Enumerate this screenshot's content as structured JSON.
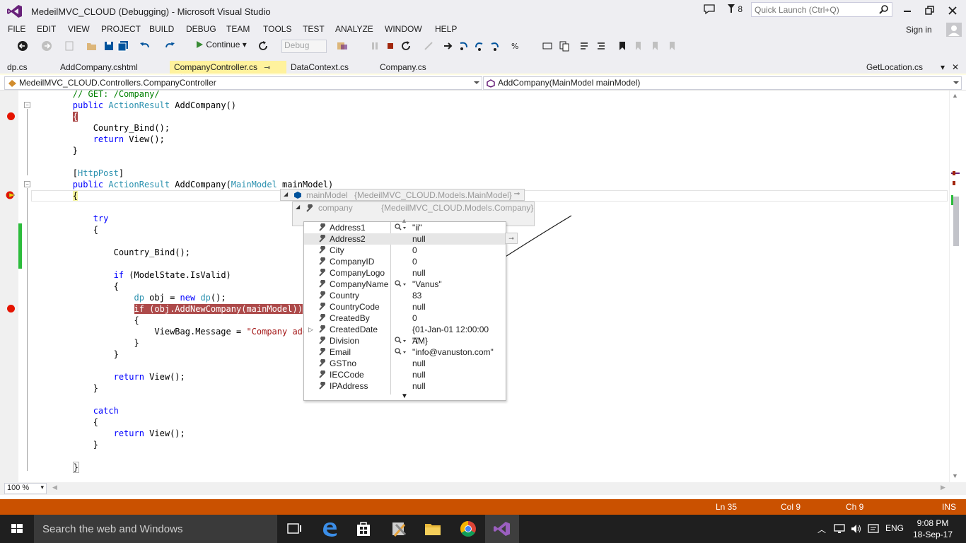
{
  "window": {
    "title": "MedeilMVC_CLOUD (Debugging) - Microsoft Visual Studio",
    "notification_count": "8",
    "quick_launch_placeholder": "Quick Launch (Ctrl+Q)",
    "accent": "#68217a"
  },
  "menu": {
    "items": [
      "FILE",
      "EDIT",
      "VIEW",
      "PROJECT",
      "BUILD",
      "DEBUG",
      "TEAM",
      "TOOLS",
      "TEST",
      "ANALYZE",
      "WINDOW",
      "HELP"
    ],
    "signin": "Sign in"
  },
  "toolbar": {
    "continue_label": "Continue",
    "config_value": "Debug"
  },
  "tabs": {
    "items": [
      {
        "label": "dp.cs"
      },
      {
        "label": "AddCompany.cshtml"
      },
      {
        "label": "CompanyController.cs",
        "active": true
      },
      {
        "label": "DataContext.cs"
      },
      {
        "label": "Company.cs"
      }
    ],
    "right_tab": "GetLocation.cs",
    "active_color": "#fff29d"
  },
  "nav": {
    "class_path": "MedeilMVC_CLOUD.Controllers.CompanyController",
    "member": "AddCompany(MainModel mainModel)"
  },
  "code": {
    "l0": "// GET: /Company/",
    "l1a": "public ",
    "l1b": "ActionResult",
    "l1c": " AddCompany()",
    "l2": "{",
    "l4": "Country_Bind();",
    "l5a": "return",
    "l5b": " View();",
    "l6": "}",
    "l8a": "[",
    "l8b": "HttpPost",
    "l8c": "]",
    "l9a": "public ",
    "l9b": "ActionResult",
    "l9c": " AddCompany(",
    "l9d": "MainModel",
    "l9e": " mainModel)",
    "l10": "{",
    "l12": "try",
    "l13": "{",
    "l15": "Country_Bind();",
    "l17a": "if",
    "l17b": " (ModelState.IsValid)",
    "l18": "{",
    "l19a": "dp",
    "l19b": " obj = ",
    "l19c": "new",
    "l19d": " ",
    "l19e": "dp",
    "l19f": "();",
    "l20": "if (obj.AddNewCompany(mainModel))",
    "l21": "{",
    "l22a": "ViewBag.Message = ",
    "l22b": "\"Company adde",
    "l23": "}",
    "l24": "}",
    "l26a": "return",
    "l26b": " View();",
    "l27": "}",
    "l29": "catch",
    "l30": "{",
    "l31a": "return",
    "l31b": " View();",
    "l32": "}",
    "l34": "}"
  },
  "datatip": {
    "main_name": "mainModel",
    "main_value": "{MedeilMVC_CLOUD.Models.MainModel}",
    "company_name": "company",
    "company_value": "{MedeilMVC_CLOUD.Models.Company}",
    "rows": [
      {
        "name": "Address1",
        "value": "\"ii\""
      },
      {
        "name": "Address2",
        "value": "null"
      },
      {
        "name": "City",
        "value": "0"
      },
      {
        "name": "CompanyID",
        "value": "0"
      },
      {
        "name": "CompanyLogo",
        "value": "null"
      },
      {
        "name": "CompanyName",
        "value": "\"Vanus\""
      },
      {
        "name": "Country",
        "value": "83"
      },
      {
        "name": "CountryCode",
        "value": "null"
      },
      {
        "name": "CreatedBy",
        "value": "0"
      },
      {
        "name": "CreatedDate",
        "value": "{01-Jan-01 12:00:00 AM}"
      },
      {
        "name": "Division",
        "value": "\"i\""
      },
      {
        "name": "Email",
        "value": "\"info@vanuston.com\""
      },
      {
        "name": "GSTno",
        "value": "null"
      },
      {
        "name": "IECCode",
        "value": "null"
      },
      {
        "name": "IPAddress",
        "value": "null"
      }
    ]
  },
  "zoom": "100 %",
  "status": {
    "ln": "Ln 35",
    "col": "Col 9",
    "ch": "Ch 9",
    "mode": "INS",
    "color": "#ca5100"
  },
  "taskbar": {
    "search_placeholder": "Search the web and Windows",
    "lang": "ENG",
    "time": "9:08 PM",
    "date": "18-Sep-17"
  }
}
